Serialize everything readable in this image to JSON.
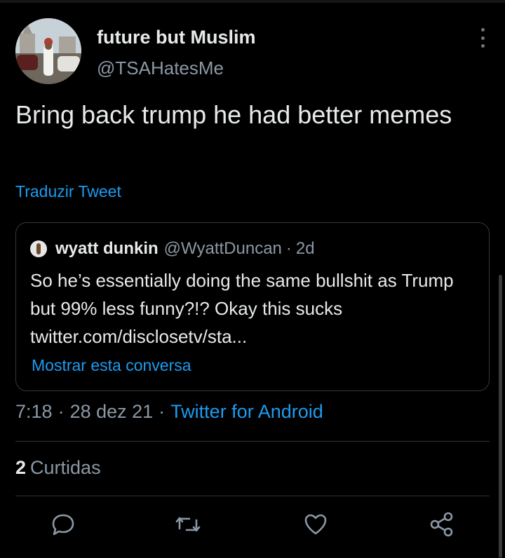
{
  "author": {
    "display_name": "future but Muslim",
    "handle": "@TSAHatesMe",
    "avatar_icon": "avatar-photo-icon"
  },
  "tweet": {
    "text": "Bring back trump he had better memes",
    "translate_label": "Traduzir Tweet"
  },
  "quoted_tweet": {
    "display_name": "wyatt dunkin",
    "handle": "@WyattDuncan",
    "separator": "·",
    "time": "2d",
    "text": "So he’s essentially doing the same bullshit as Trump but 99% less funny?!? Okay this sucks twitter.com/disclosetv/sta...",
    "show_conversation_label": "Mostrar esta conversa"
  },
  "meta": {
    "time": "7:18",
    "separator": "·",
    "date": "28 dez 21",
    "source": "Twitter for Android"
  },
  "stats": {
    "likes_count": "2",
    "likes_label": "Curtidas"
  },
  "actions": {
    "icons": [
      "reply-icon",
      "retweet-icon",
      "like-icon",
      "share-icon"
    ]
  },
  "colors": {
    "background": "#000000",
    "text": "#e7e9ea",
    "secondary": "#8b98a5",
    "accent": "#1d9bf0",
    "border": "#2f3336"
  }
}
